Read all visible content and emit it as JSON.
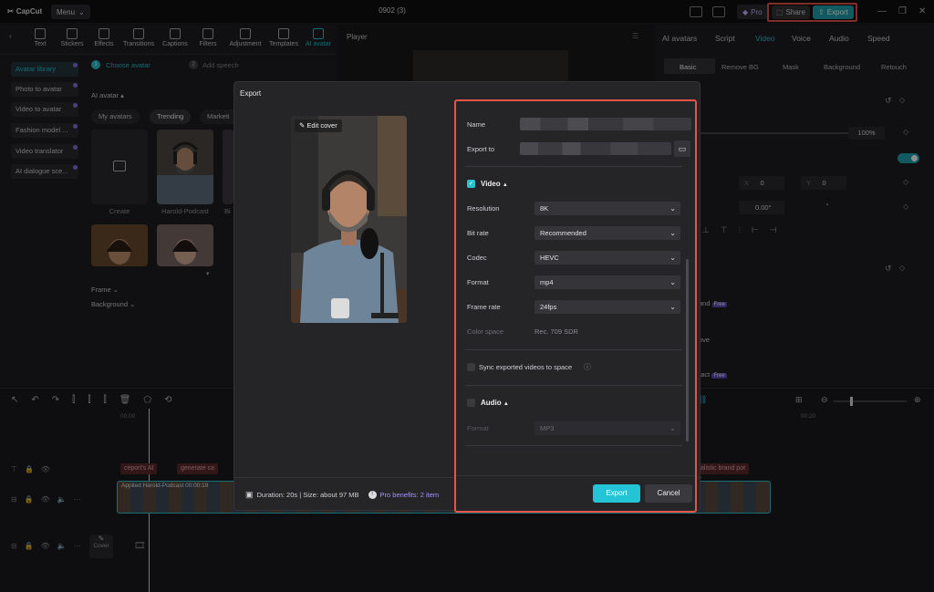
{
  "app": {
    "logo": "CapCut",
    "menu": "Menu",
    "title": "0902 (3)",
    "pro": "Pro",
    "share": "Share",
    "export": "Export"
  },
  "toolbar": {
    "items": [
      "Text",
      "Stickers",
      "Effects",
      "Transitions",
      "Captions",
      "Filters",
      "Adjustment",
      "Templates",
      "AI avatar"
    ]
  },
  "steps": {
    "one": "Choose avatar",
    "two": "Add speech"
  },
  "sidebar": {
    "items": [
      "Avatar library",
      "Photo to avatar",
      "Video to avatar",
      "Fashion model ...",
      "Video translator",
      "AI dialogue sce..."
    ]
  },
  "avatar": {
    "heading": "AI avatar",
    "tabs": [
      "My avatars",
      "Trending",
      "Marketi"
    ],
    "create": "Create",
    "harold": "Harold-Podcast",
    "frame": "Frame",
    "background": "Background"
  },
  "player": {
    "title": "Player"
  },
  "right": {
    "tabs": [
      "AI avatars",
      "Script",
      "Video",
      "Voice",
      "Audio",
      "Speed"
    ],
    "subtabs": [
      "Basic",
      "Remove BG",
      "Mask",
      "Background",
      "Retouch"
    ],
    "scale": "100%",
    "x": "0",
    "y": "0",
    "rotate": "0.00°",
    "frame_label": "and",
    "move_label": "ove",
    "contact_label": "ntact",
    "free": "Free"
  },
  "timeline": {
    "ts1": "00:00",
    "ts2": "00:20",
    "tag1": "ceport's AI",
    "tag2": "generate ca",
    "tag3": "alistic brand pot",
    "clip_label": "Applied  Harold-Podcast  00:00:19",
    "cover": "Cover"
  },
  "export": {
    "title": "Export",
    "edit_cover": "Edit cover",
    "name_label": "Name",
    "export_to_label": "Export to",
    "video_label": "Video",
    "resolution_label": "Resolution",
    "resolution": "8K",
    "bitrate_label": "Bit rate",
    "bitrate": "Recommended",
    "codec_label": "Codec",
    "codec": "HEVC",
    "format_label": "Format",
    "format": "mp4",
    "framerate_label": "Frame rate",
    "framerate": "24fps",
    "colorspace_label": "Color space",
    "colorspace": "Rec. 709 SDR",
    "sync_label": "Sync exported videos to space",
    "audio_label": "Audio",
    "audio_format_label": "Format",
    "audio_format": "MP3",
    "duration": "Duration: 20s | Size: about 97 MB",
    "pro_benefits": "Pro benefits: 2 item",
    "export_btn": "Export",
    "cancel_btn": "Cancel"
  },
  "colors": {
    "accent": "#22c4d6",
    "highlight": "#e5534b",
    "pro": "#8a70e8"
  }
}
